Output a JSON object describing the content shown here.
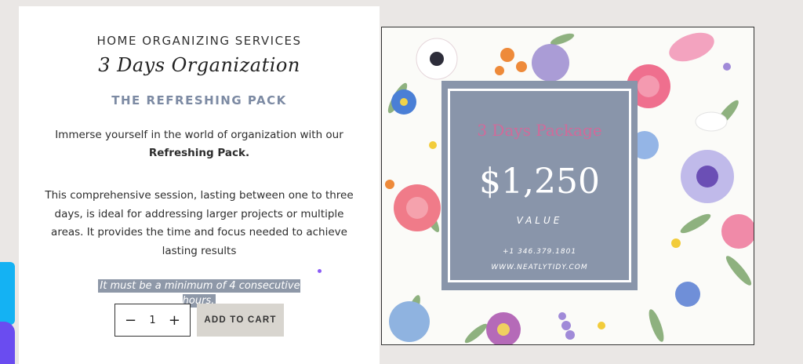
{
  "product": {
    "eyebrow": "HOME ORGANIZING SERVICES",
    "title": "3 Days Organization",
    "subtitle": "THE REFRESHING PACK",
    "desc_line1": "Immerse yourself in the world of organization with our",
    "desc_bold": "Refreshing Pack.",
    "desc2": "This comprehensive session, lasting between one to three days, is ideal for addressing larger projects or multiple areas. It provides the time and focus needed to achieve lasting results",
    "note": "It must be a minimum of 4 consecutive hours."
  },
  "cart": {
    "minus": "−",
    "quantity": "1",
    "plus": "+",
    "add_label": "ADD TO CART"
  },
  "price_card": {
    "title": "3 Days Package",
    "price": "$1,250",
    "value_label": "VALUE",
    "phone": "+1 346.379.1801",
    "website": "WWW.NEATLYTIDY.COM"
  },
  "colors": {
    "accent_blue": "#8995aa",
    "pink_title": "#d16a9a",
    "highlight": "#8e98a8",
    "button_bg": "#d8d5cf"
  }
}
